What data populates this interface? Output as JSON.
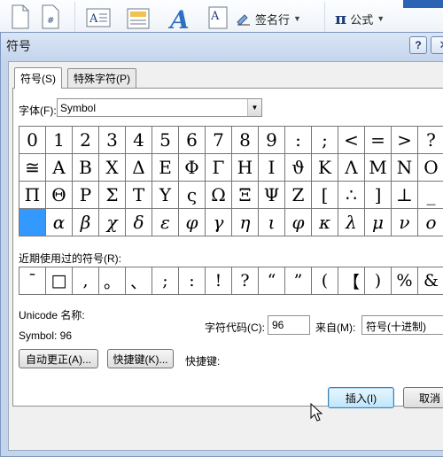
{
  "ribbon": {
    "signature_label": "签名行",
    "formula_label": "公式",
    "formula_symbol": "π"
  },
  "dialog": {
    "title": "符号",
    "help_label": "?",
    "close_label": "✕",
    "tabs": [
      {
        "label": "符号(S)"
      },
      {
        "label": "特殊字符(P)"
      }
    ],
    "font_label": "字体(F):",
    "font_value": "Symbol",
    "symbols": [
      "0",
      "1",
      "2",
      "3",
      "4",
      "5",
      "6",
      "7",
      "8",
      "9",
      ":",
      ";",
      "<",
      "=",
      ">",
      "?",
      "≅",
      "Α",
      "Β",
      "Χ",
      "Δ",
      "Ε",
      "Φ",
      "Γ",
      "Η",
      "Ι",
      "ϑ",
      "Κ",
      "Λ",
      "Μ",
      "Ν",
      "Ο",
      "Π",
      "Θ",
      "Ρ",
      "Σ",
      "Τ",
      "Υ",
      "ς",
      "Ω",
      "Ξ",
      "Ψ",
      "Ζ",
      "[",
      "∴",
      "]",
      "⊥",
      "_",
      "",
      "α",
      "β",
      "χ",
      "δ",
      "ε",
      "φ",
      "γ",
      "η",
      "ι",
      "φ",
      "κ",
      "λ",
      "μ",
      "ν",
      "ο"
    ],
    "selected_index": 48,
    "recent_label": "近期使用过的符号(R):",
    "recent_symbols": [
      "¯",
      "□",
      ",",
      "。",
      "、",
      ";",
      ":",
      "!",
      "?",
      "“",
      "”",
      "(",
      "【",
      ")",
      "%",
      "&"
    ],
    "unicode_name_label": "Unicode 名称:",
    "unicode_value": "Symbol: 96",
    "char_code_label": "字符代码(C):",
    "char_code_value": "96",
    "from_label": "来自(M):",
    "from_value": "符号(十进制)",
    "autocorrect_label": "自动更正(A)...",
    "shortcut_button_label": "快捷键(K)...",
    "shortcut_key_label": "快捷键:",
    "insert_label": "插入(I)",
    "cancel_label": "取消"
  }
}
